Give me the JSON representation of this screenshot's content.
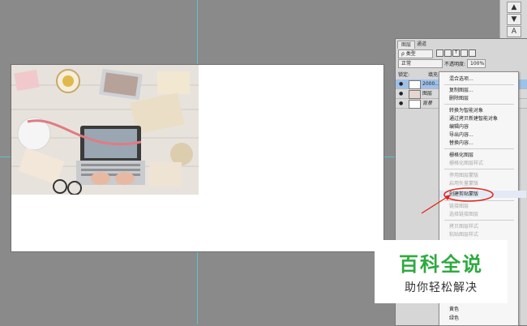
{
  "layers_panel": {
    "tabs": [
      "图层",
      "通道"
    ],
    "filter_kind": "ρ 类型",
    "blend_mode": "正常",
    "opacity_label": "不透明度:",
    "opacity_value": "100%",
    "lock_label": "锁定:",
    "fill_label": "填充:",
    "layers": [
      {
        "name": "2000...",
        "selected": true
      },
      {
        "name": "图层",
        "selected": false
      },
      {
        "name": "背景",
        "selected": false
      }
    ]
  },
  "context_menu": {
    "items": [
      {
        "label": "混合选项...",
        "disabled": false
      },
      {
        "label": "复制图层...",
        "disabled": false
      },
      {
        "label": "删除图层",
        "disabled": false
      },
      {
        "label": "转换为智能对象",
        "disabled": false
      },
      {
        "label": "通过拷贝新建智能对象",
        "disabled": false
      },
      {
        "label": "编辑内容",
        "disabled": false
      },
      {
        "label": "导出内容...",
        "disabled": false
      },
      {
        "label": "替换内容...",
        "disabled": false
      },
      {
        "label": "栅格化图层",
        "disabled": false
      },
      {
        "label": "栅格化图层样式",
        "disabled": true
      },
      {
        "label": "停用图层蒙版",
        "disabled": true
      },
      {
        "label": "启用矢量蒙版",
        "disabled": true
      },
      {
        "label": "创建剪贴蒙版",
        "disabled": false,
        "highlighted": true
      },
      {
        "label": "链接图层",
        "disabled": true
      },
      {
        "label": "选择链接图层",
        "disabled": true
      },
      {
        "label": "拷贝图层样式",
        "disabled": true
      },
      {
        "label": "粘贴图层样式",
        "disabled": true
      },
      {
        "label": "黄色",
        "disabled": false
      },
      {
        "label": "绿色",
        "disabled": false
      }
    ]
  },
  "tool_strip": {
    "buttons": [
      "▲",
      "▼",
      "A"
    ]
  },
  "watermark": {
    "title": "百科全说",
    "subtitle": "助你轻松解决"
  },
  "colors": {
    "accent_green": "#2eaa3f",
    "annotation_red": "#e0261b",
    "guide_cyan": "#4fd3e8",
    "selection_blue": "#9ec1ea"
  }
}
